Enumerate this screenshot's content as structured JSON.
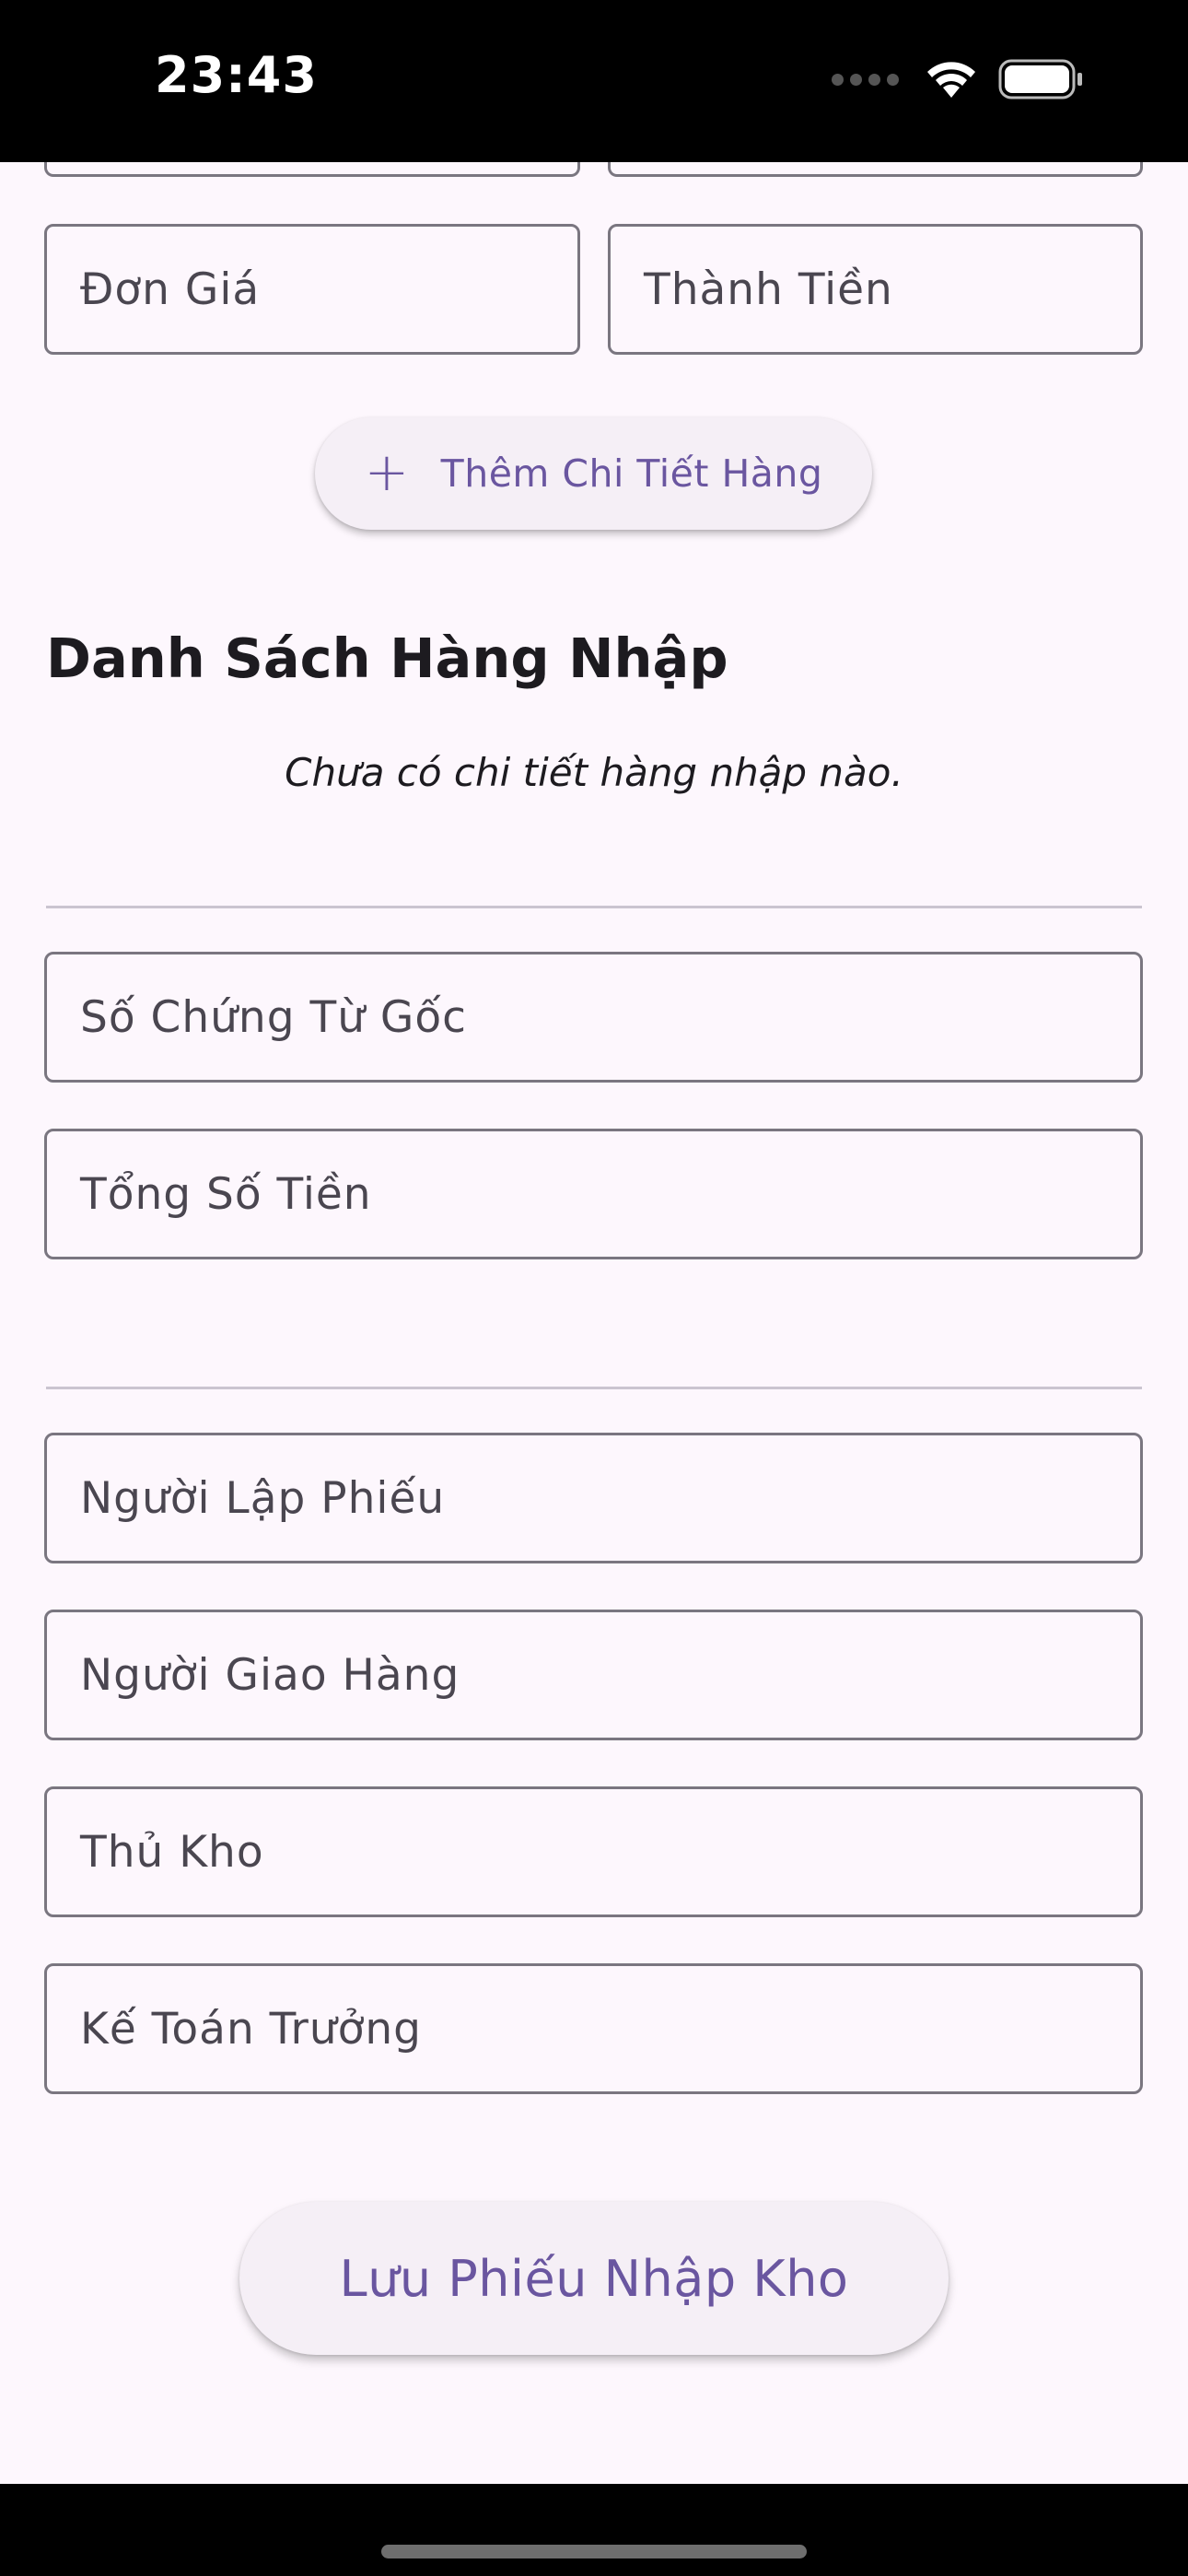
{
  "status_bar": {
    "time": "23:43"
  },
  "form": {
    "fields_top": {
      "unit_price": "Đơn Giá",
      "total_amount": "Thành Tiền"
    },
    "add_detail_button": "Thêm Chi Tiết Hàng",
    "list_title": "Danh Sách Hàng Nhập",
    "empty_message": "Chưa có chi tiết hàng nhập nào.",
    "document_fields": {
      "original_doc_number": "Số Chứng Từ Gốc",
      "grand_total": "Tổng Số Tiền"
    },
    "signature_fields": {
      "prepared_by": "Người Lập Phiếu",
      "delivered_by": "Người Giao Hàng",
      "storekeeper": "Thủ Kho",
      "chief_accountant": "Kế Toán Trưởng"
    },
    "save_button": "Lưu Phiếu Nhập Kho"
  },
  "colors": {
    "background": "#fdf7fd",
    "accent": "#6a56a0",
    "outline": "#7a7680"
  },
  "icons": {
    "add": "plus-icon",
    "signal": "signal-icon",
    "wifi": "wifi-icon",
    "battery": "battery-icon"
  }
}
